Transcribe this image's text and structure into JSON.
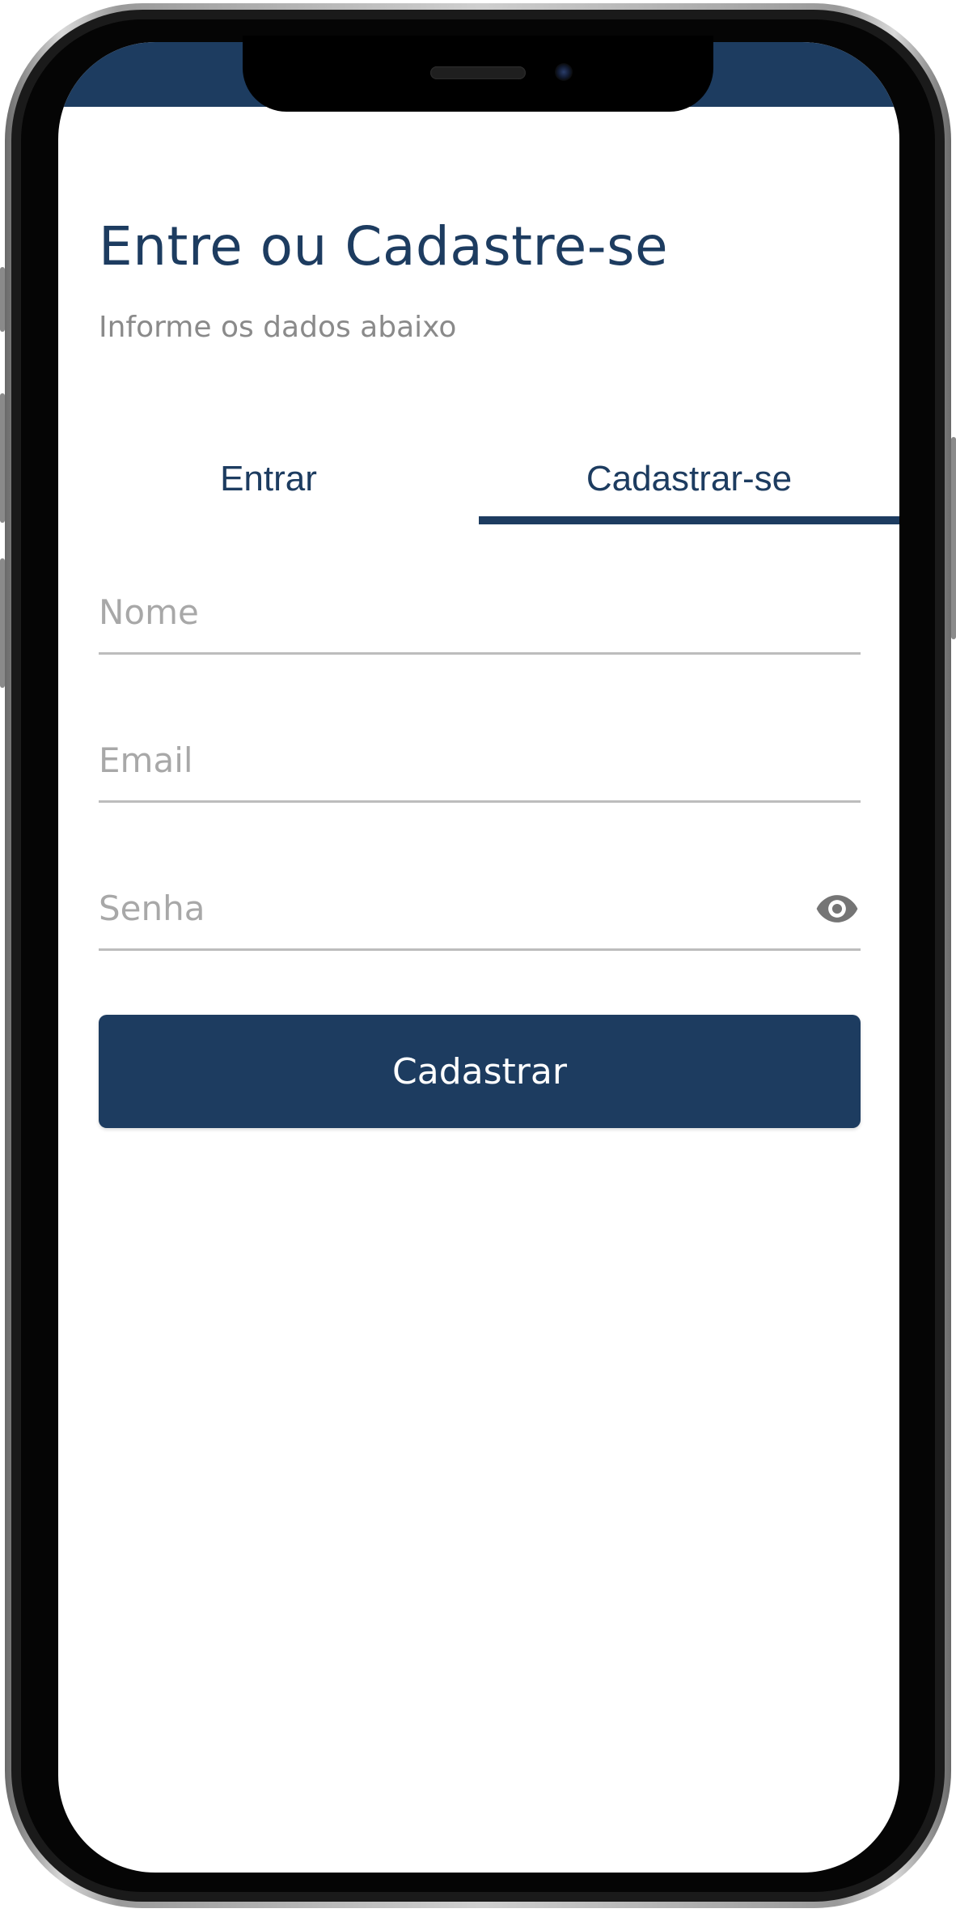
{
  "header": {
    "title": "Entre ou Cadastre-se",
    "subtitle": "Informe os dados abaixo"
  },
  "tabs": [
    {
      "label": "Entrar",
      "active": false
    },
    {
      "label": "Cadastrar-se",
      "active": true
    }
  ],
  "form": {
    "name": {
      "placeholder": "Nome",
      "value": ""
    },
    "email": {
      "placeholder": "Email",
      "value": ""
    },
    "password": {
      "placeholder": "Senha",
      "value": ""
    },
    "submit_label": "Cadastrar"
  },
  "colors": {
    "primary": "#1d3c60",
    "placeholder": "#a8a8a8",
    "subtitle": "#8a8a8a",
    "underline": "#bdbdbd"
  },
  "icons": {
    "password_toggle": "eye-icon"
  }
}
